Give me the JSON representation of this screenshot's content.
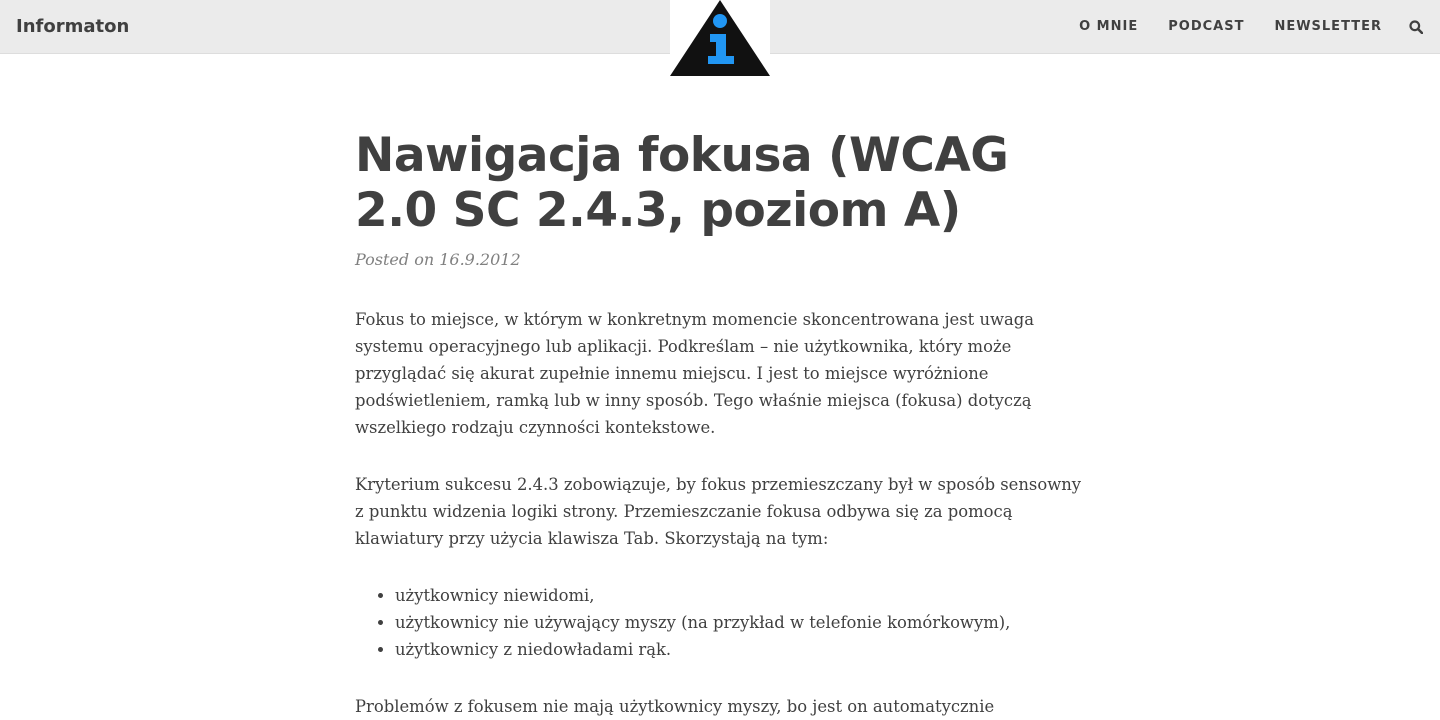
{
  "header": {
    "brand": "Informaton",
    "nav": [
      "O MNIE",
      "PODCAST",
      "NEWSLETTER"
    ],
    "search_icon": "search-icon",
    "logo_icon": "info-triangle-logo-icon",
    "colors": {
      "bar_background": "#ebebeb",
      "logo_triangle": "#111111",
      "logo_accent": "#2196f3"
    }
  },
  "article": {
    "title": "Nawigacja fokusa (WCAG 2.0 SC 2.4.3, poziom A)",
    "meta": "Posted on 16.9.2012",
    "paragraphs": [
      "Fokus to miejsce, w którym w konkretnym momencie skoncentrowana jest uwaga systemu operacyjnego lub aplikacji. Podkreślam – nie użytkownika, który może przyglądać się akurat zupełnie innemu miejscu. I jest to miejsce wyróżnione podświetleniem, ramką lub w inny sposób. Tego właśnie miejsca (fokusa) dotyczą wszelkiego rodzaju czynności kontekstowe.",
      "Kryterium sukcesu 2.4.3 zobowiązuje, by fokus przemieszczany był w sposób sensowny z punktu widzenia logiki strony. Przemieszczanie fokusa odbywa się za pomocą klawiatury przy użycia klawisza Tab. Skorzystają na tym:"
    ],
    "list": [
      "użytkownicy niewidomi,",
      "użytkownicy nie używający myszy (na przykład w telefonie komórkowym),",
      "użytkownicy z niedowładami rąk."
    ],
    "closing": "Problemów z fokusem nie mają użytkownicy myszy, bo jest on automatycznie"
  }
}
